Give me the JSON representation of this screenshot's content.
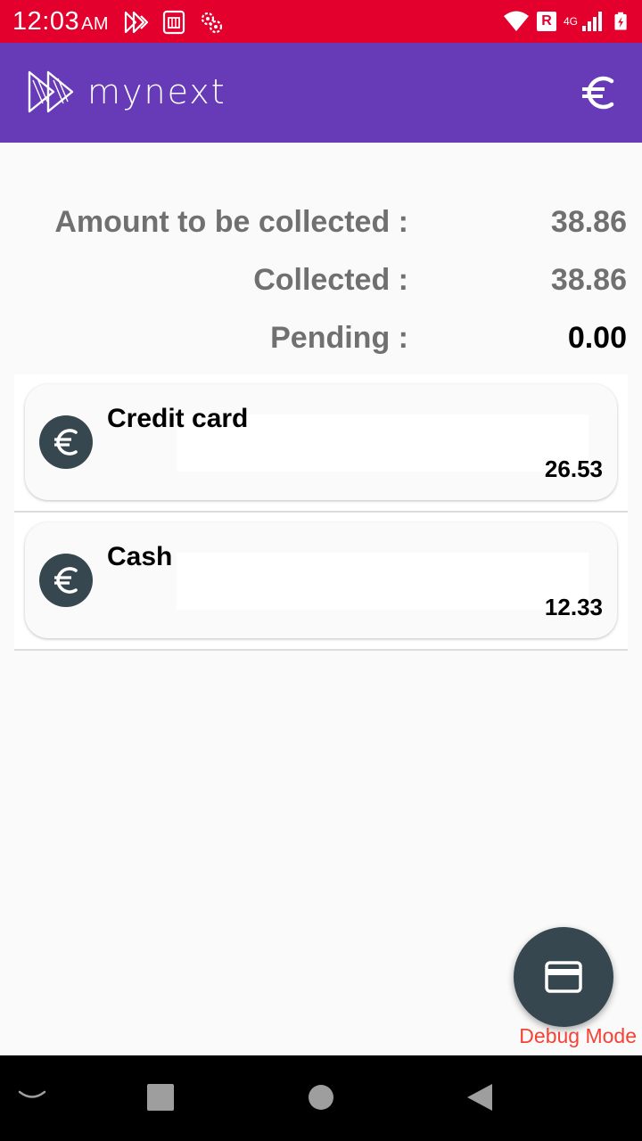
{
  "status_bar": {
    "time": "12:03",
    "ampm": "AM",
    "roaming": "R",
    "network": "4G"
  },
  "app_bar": {
    "logo_text": "mynext",
    "currency_icon": "euro-icon"
  },
  "summary": {
    "amount_label": "Amount to be collected :",
    "amount_value": "38.86",
    "collected_label": "Collected :",
    "collected_value": "38.86",
    "pending_label": "Pending :",
    "pending_value": "0.00"
  },
  "payments": [
    {
      "name": "Credit card",
      "amount": "26.53",
      "icon": "euro-icon"
    },
    {
      "name": "Cash",
      "amount": "12.33",
      "icon": "euro-icon"
    }
  ],
  "fab": {
    "icon": "credit-card-icon"
  },
  "debug_label": "Debug Mode",
  "colors": {
    "status_bar": "#e3002c",
    "app_bar": "#673ab7",
    "icon_bg": "#37474f",
    "debug": "#f44336"
  }
}
